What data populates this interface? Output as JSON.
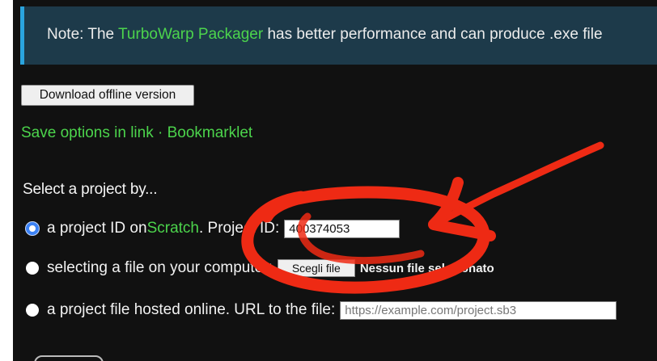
{
  "note": {
    "prefix": "Note: The ",
    "link": "TurboWarp Packager",
    "suffix": " has better performance and can produce .exe file"
  },
  "download_button": "Download offline version",
  "links": {
    "save_options": "Save options in link",
    "separator": " · ",
    "bookmarklet": "Bookmarklet"
  },
  "section_title": "Select a project by...",
  "options": {
    "project_id": {
      "prefix": "a project ID on ",
      "link": "Scratch",
      "suffix": ". Project ID:",
      "value": "400374053",
      "selected": true
    },
    "file": {
      "label": "selecting a file on your computer:",
      "button": "Scegli file",
      "status": "Nessun file selezionato"
    },
    "url": {
      "label": "a project file hosted online. URL to the file:",
      "placeholder": "https://example.com/project.sb3"
    }
  },
  "colors": {
    "accent": "#4cd44c",
    "panel_bg": "#111111",
    "note_bg": "#1d3a4a",
    "note_border": "#2aa4de",
    "scribble": "#ee2a14",
    "radio_selected": "#3b82f6"
  }
}
